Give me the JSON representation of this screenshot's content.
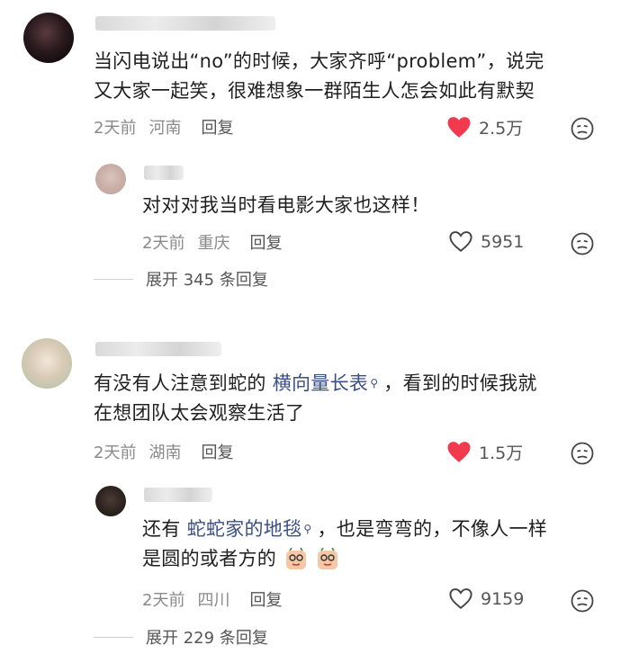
{
  "comments": [
    {
      "text_line1": "当闪电说出“no”的时候，大家齐呼“problem”，说完",
      "text_line2": "又大家一起笑，很难想象一群陌生人怎会如此有默契",
      "time": "2天前",
      "location": "河南",
      "reply_label": "回复",
      "likes": "2.5万",
      "liked": true,
      "reply": {
        "text": "对对对我当时看电影大家也这样！",
        "time": "2天前",
        "location": "重庆",
        "reply_label": "回复",
        "likes": "5951",
        "liked": false
      },
      "expand": {
        "label": "展开",
        "count": "345",
        "suffix": "条回复"
      }
    },
    {
      "text_line1_pre": "有没有人注意到蛇的",
      "text_line1_link": "横向量长表",
      "text_line1_post": "，看到的时候我就",
      "text_line2": "在想团队太会观察生活了",
      "time": "2天前",
      "location": "湖南",
      "reply_label": "回复",
      "likes": "1.5万",
      "liked": true,
      "reply": {
        "text_line1_pre": "还有",
        "text_line1_link": "蛇蛇家的地毯",
        "text_line1_post": "，也是弯弯的，不像人一样",
        "text_line2": "是圆的或者方的",
        "time": "2天前",
        "location": "四川",
        "reply_label": "回复",
        "likes": "9159",
        "liked": false
      },
      "expand": {
        "label": "展开",
        "count": "229",
        "suffix": "条回复"
      }
    }
  ],
  "colors": {
    "heart": "#f23a4f",
    "link": "#3b4f85",
    "meta": "#8a8a8a"
  },
  "icons": [
    "heart-filled-icon",
    "heart-outline-icon",
    "dislike-face-icon",
    "search-icon",
    "sticker-emoji"
  ]
}
